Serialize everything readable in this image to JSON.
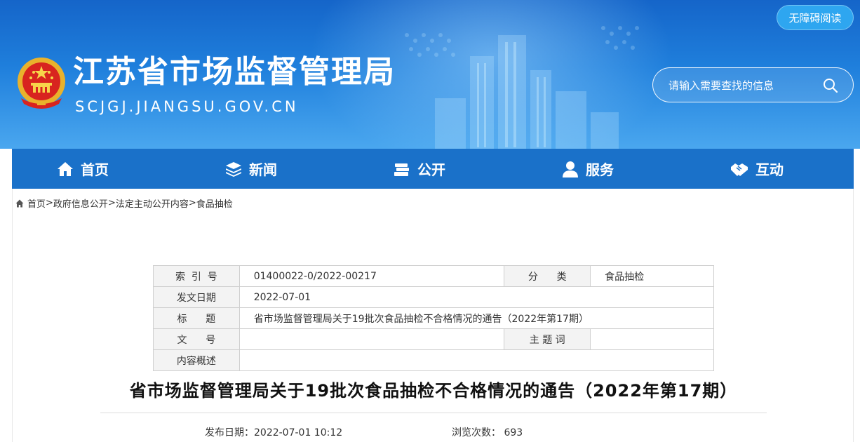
{
  "header": {
    "site_title": "江苏省市场监督管理局",
    "site_domain": "SCJGJ.JIANGSU.GOV.CN",
    "accessibility_label": "无障碍阅读",
    "search_placeholder": "请输入需要查找的信息"
  },
  "nav": {
    "items": [
      {
        "label": "首页",
        "icon": "home-icon"
      },
      {
        "label": "新闻",
        "icon": "layers-icon"
      },
      {
        "label": "公开",
        "icon": "books-icon"
      },
      {
        "label": "服务",
        "icon": "user-icon"
      },
      {
        "label": "互动",
        "icon": "handshake-icon"
      }
    ]
  },
  "breadcrumb": {
    "items": [
      "首页",
      "政府信息公开",
      "法定主动公开内容",
      "食品抽检"
    ],
    "separator": ">"
  },
  "meta": {
    "index_label": "索  引  号",
    "index_value": "01400022-0/2022-00217",
    "category_label": "分      类",
    "category_value": "食品抽检",
    "date_label": "发文日期",
    "date_value": "2022-07-01",
    "title_label": "标      题",
    "title_value": "省市场监督管理局关于19批次食品抽检不合格情况的通告（2022年第17期）",
    "docno_label": "文      号",
    "docno_value": "",
    "keyword_label": "主 题 词",
    "keyword_value": "",
    "summary_label": "内容概述",
    "summary_value": ""
  },
  "article": {
    "title": "省市场监督管理局关于19批次食品抽检不合格情况的通告（2022年第17期）",
    "publish_label": "发布日期：",
    "publish_value": "2022-07-01 10:12",
    "views_label": "浏览次数：",
    "views_value": "693"
  },
  "colors": {
    "header_blue": "#1f7fdc",
    "nav_blue": "#1a71c9",
    "a11y_button": "#2ea6f0"
  }
}
